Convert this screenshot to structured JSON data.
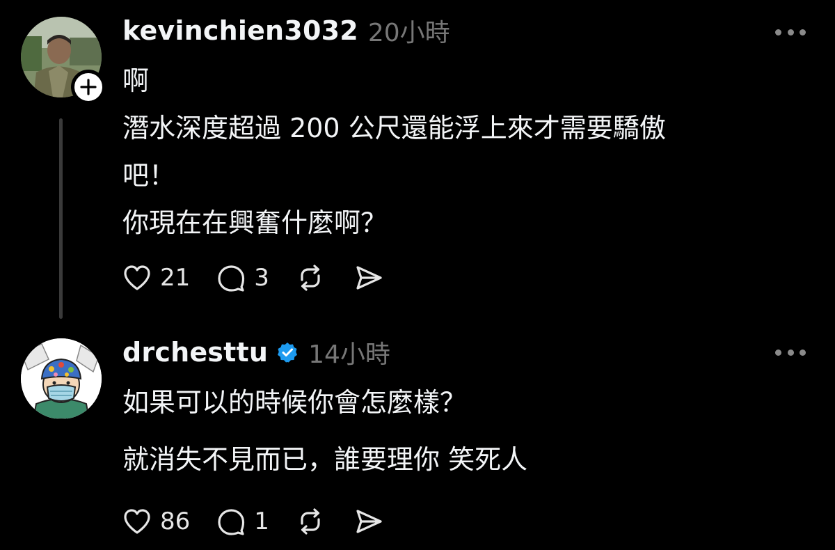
{
  "colors": {
    "background": "#000000",
    "text": "#f3f5f7",
    "muted": "#777777",
    "verified": "#1d9bf0"
  },
  "posts": [
    {
      "username": "kevinchien3032",
      "timestamp": "20小時",
      "verified": false,
      "lines": [
        "啊",
        "潛水深度超過 200 公尺還能浮上來才需要驕傲",
        "吧！",
        "你現在在興奮什麼啊？"
      ],
      "likes": "21",
      "replies": "3"
    },
    {
      "username": "drchesttu",
      "timestamp": "14小時",
      "verified": true,
      "lines": [
        "如果可以的時候你會怎麼樣？",
        "就消失不見而已，誰要理你 笑死人"
      ],
      "likes": "86",
      "replies": "1"
    }
  ],
  "icons": {
    "like": "heart-icon",
    "reply": "speech-bubble-icon",
    "repost": "repost-icon",
    "share": "send-icon",
    "more": "more-dots-icon",
    "follow": "plus-icon",
    "verified": "verified-badge-icon"
  }
}
